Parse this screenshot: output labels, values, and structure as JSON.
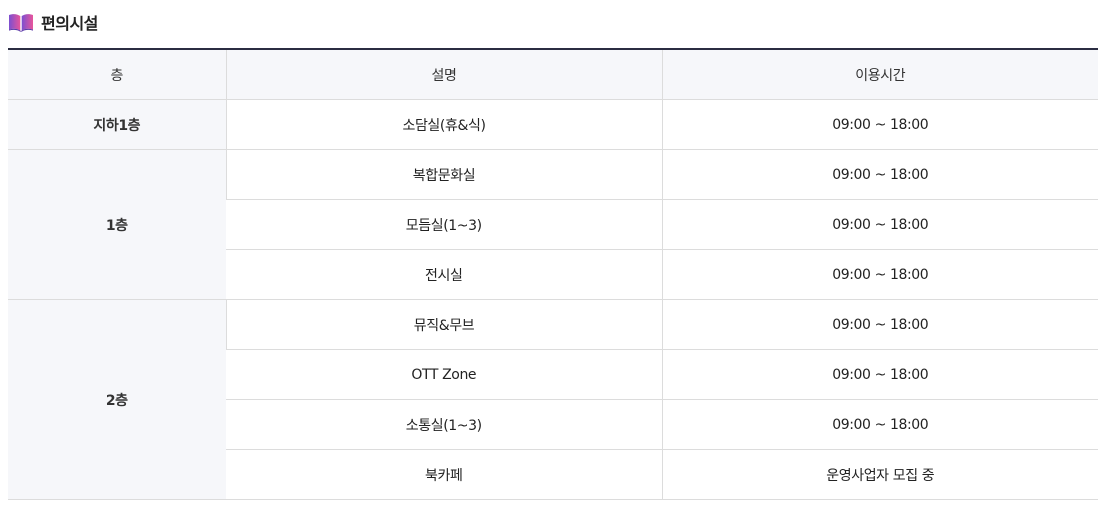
{
  "section": {
    "title": "편의시설",
    "icon": "open-book-icon",
    "icon_colors": [
      "#7b4fd1",
      "#e8559b"
    ]
  },
  "table": {
    "headers": [
      "층",
      "설명",
      "이용시간"
    ],
    "groups": [
      {
        "floor": "지하1층",
        "rows": [
          {
            "desc": "소담실(휴&식)",
            "hours": "09:00 ~ 18:00"
          }
        ]
      },
      {
        "floor": "1층",
        "rows": [
          {
            "desc": "복합문화실",
            "hours": "09:00 ~ 18:00"
          },
          {
            "desc": "모듬실(1~3)",
            "hours": "09:00 ~ 18:00"
          },
          {
            "desc": "전시실",
            "hours": "09:00 ~ 18:00"
          }
        ]
      },
      {
        "floor": "2층",
        "rows": [
          {
            "desc": "뮤직&무브",
            "hours": "09:00 ~ 18:00"
          },
          {
            "desc": "OTT Zone",
            "hours": "09:00 ~ 18:00"
          },
          {
            "desc": "소통실(1~3)",
            "hours": "09:00 ~ 18:00"
          },
          {
            "desc": "북카페",
            "hours": "운영사업자 모집 중"
          }
        ]
      }
    ]
  }
}
